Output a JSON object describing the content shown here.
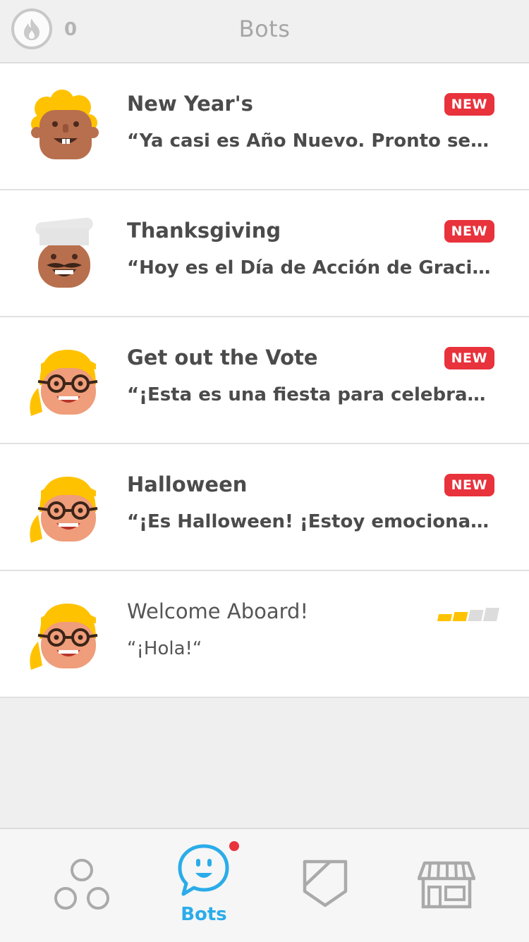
{
  "header": {
    "streak_count": "0",
    "title": "Bots"
  },
  "bots": [
    {
      "name": "New Year's",
      "message": "“Ya casi es Año Nuevo.  Pronto será...",
      "badge": "NEW",
      "avatar": "curly-blonde-bot-avatar"
    },
    {
      "name": "Thanksgiving",
      "message": "“Hoy es el Día de Acción de Gracias....",
      "badge": "NEW",
      "avatar": "chef-bot-avatar"
    },
    {
      "name": "Get out the Vote",
      "message": "“¡Esta es una fiesta para celebrar las...",
      "badge": "NEW",
      "avatar": "glasses-blonde-bot-avatar"
    },
    {
      "name": "Halloween",
      "message": "“¡Es Halloween! ¡Estoy emocionada!“",
      "badge": "NEW",
      "avatar": "glasses-blonde-bot-avatar"
    },
    {
      "name": "Welcome Aboard!",
      "message": "“¡Hola!“",
      "avatar": "glasses-blonde-bot-avatar",
      "progress_filled": 2,
      "progress_total": 4
    }
  ],
  "tabbar": {
    "active_label": "Bots",
    "icons": [
      "learn-circles-icon",
      "bots-chat-icon",
      "shield-icon",
      "shop-icon"
    ]
  },
  "colors": {
    "badge_red": "#e8323c",
    "active_blue": "#2bace9",
    "progress_gold": "#ffc200",
    "progress_empty": "#dcdcdc"
  }
}
